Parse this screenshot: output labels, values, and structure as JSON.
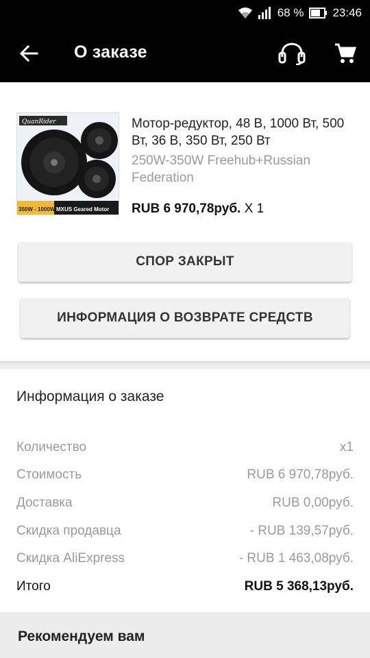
{
  "status_bar": {
    "battery": "68 %",
    "time": "23:46"
  },
  "app_bar": {
    "title": "О заказе",
    "icons": [
      "arrow-back-icon",
      "headset-icon",
      "cart-icon"
    ]
  },
  "product": {
    "image_brand_text": "QuanRider",
    "image_caption_left": "350W - 1000W",
    "image_caption_right": "MXUS Geared Motor",
    "title": "Мотор-редуктор, 48 В, 1000 Вт, 500 Вт, 36 В, 350 Вт, 250 Вт",
    "variant": "250W-350W Freehub+Russian Federation",
    "price": "RUB 6 970,78руб.",
    "quantity": "X 1"
  },
  "buttons": {
    "dispute": "СПОР ЗАКРЫТ",
    "refund": "ИНФОРМАЦИЯ О ВОЗВРАТЕ СРЕДСТВ"
  },
  "order_info": {
    "title": "Информация о заказе",
    "rows": [
      {
        "label": "Количество",
        "value": "x1"
      },
      {
        "label": "Стоимость",
        "value": "RUB 6 970,78руб."
      },
      {
        "label": "Доставка",
        "value": "RUB 0,00руб."
      },
      {
        "label": "Скидка продавца",
        "value": "- RUB 139,57руб."
      },
      {
        "label": "Скидка AliExpress",
        "value": "- RUB 1 463,08руб."
      }
    ],
    "total": {
      "label": "Итого",
      "value": "RUB 5 368,13руб."
    }
  },
  "recommend": {
    "title": "Рекомендуем вам"
  }
}
